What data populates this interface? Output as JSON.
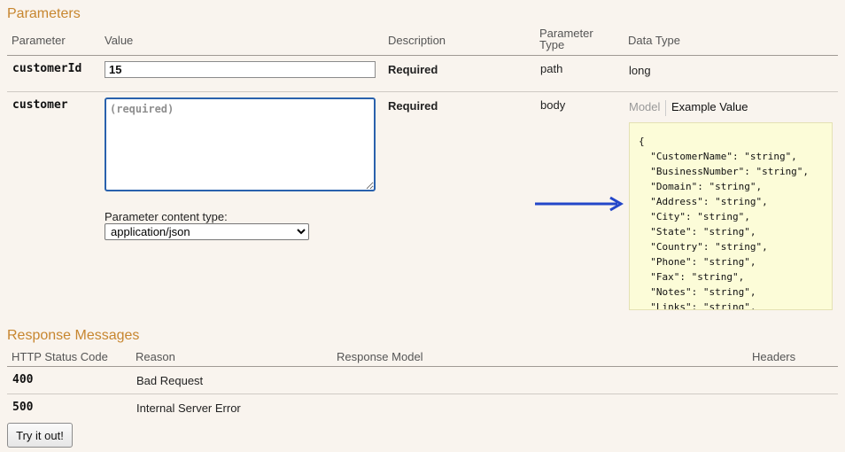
{
  "parameters": {
    "title": "Parameters",
    "headers": {
      "parameter": "Parameter",
      "value": "Value",
      "description": "Description",
      "parameter_type_line1": "Parameter",
      "parameter_type_line2": "Type",
      "data_type": "Data Type"
    },
    "rows": [
      {
        "name": "customerId",
        "value": "15",
        "description": "Required",
        "param_type": "path",
        "data_type": "long"
      },
      {
        "name": "customer",
        "placeholder": "(required)",
        "description": "Required",
        "param_type": "body"
      }
    ],
    "content_type_label": "Parameter content type:",
    "content_type_selected": "application/json",
    "tabs": {
      "model": "Model",
      "example": "Example Value"
    },
    "example_json": "{\n  \"CustomerName\": \"string\",\n  \"BusinessNumber\": \"string\",\n  \"Domain\": \"string\",\n  \"Address\": \"string\",\n  \"City\": \"string\",\n  \"State\": \"string\",\n  \"Country\": \"string\",\n  \"Phone\": \"string\",\n  \"Fax\": \"string\",\n  \"Notes\": \"string\",\n  \"Links\": \"string\","
  },
  "responses": {
    "title": "Response Messages",
    "headers": {
      "status": "HTTP Status Code",
      "reason": "Reason",
      "model": "Response Model",
      "headers": "Headers"
    },
    "rows": [
      {
        "code": "400",
        "reason": "Bad Request"
      },
      {
        "code": "500",
        "reason": "Internal Server Error"
      }
    ]
  },
  "try_button": "Try it out!",
  "colors": {
    "section_title": "#c7862f",
    "arrow": "#2346c9",
    "focus_border": "#2a62ad",
    "json_bg": "#fcfcd8"
  }
}
